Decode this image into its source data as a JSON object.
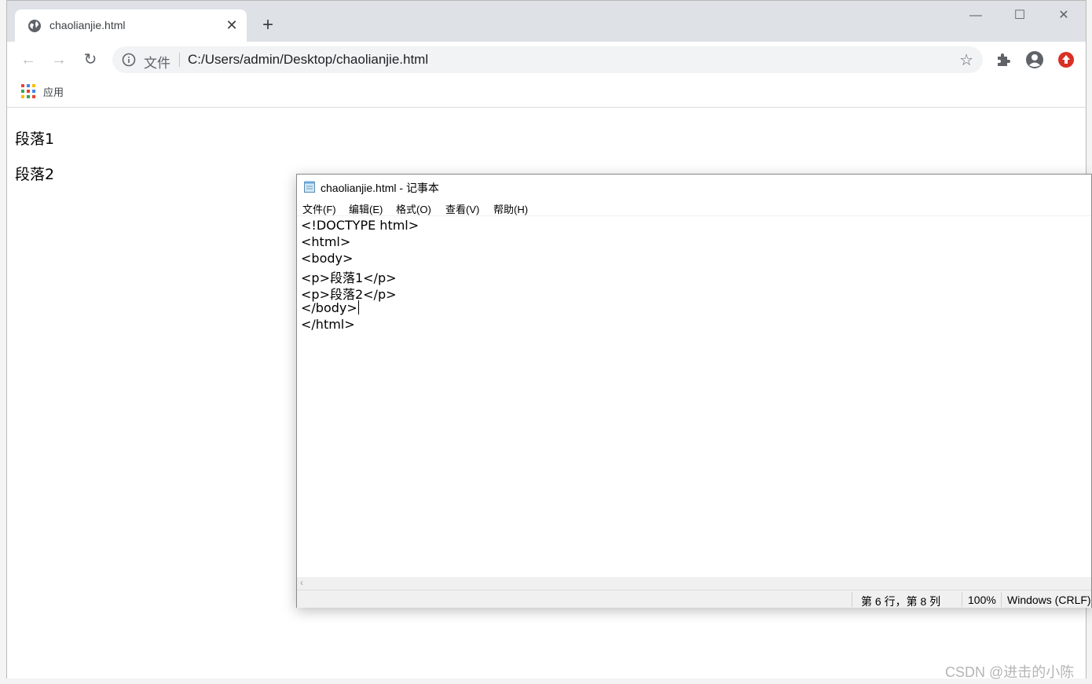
{
  "browser": {
    "tab_title": "chaolianjie.html",
    "tab_close": "✕",
    "new_tab": "+",
    "scheme_label": "文件",
    "url": "C:/Users/admin/Desktop/chaolianjie.html",
    "bookmark_apps": "应用"
  },
  "page": {
    "paragraph_1": "段落1",
    "paragraph_2": "段落2"
  },
  "notepad": {
    "title": "chaolianjie.html - 记事本",
    "menu": [
      "文件(F)",
      "编辑(E)",
      "格式(O)",
      "查看(V)",
      "帮助(H)"
    ],
    "lines": [
      "<!DOCTYPE html>",
      "<html>",
      "<body>",
      "<p>段落1</p>",
      "<p>段落2</p>",
      "</body>",
      "</html>"
    ],
    "status": {
      "position": "第 6 行，第 8 列",
      "zoom": "100%",
      "encoding": "Windows (CRLF)"
    }
  },
  "watermark": "CSDN @进击的小陈",
  "colors": {
    "update_badge": "#d93025",
    "tab_strip": "#dee1e6"
  }
}
